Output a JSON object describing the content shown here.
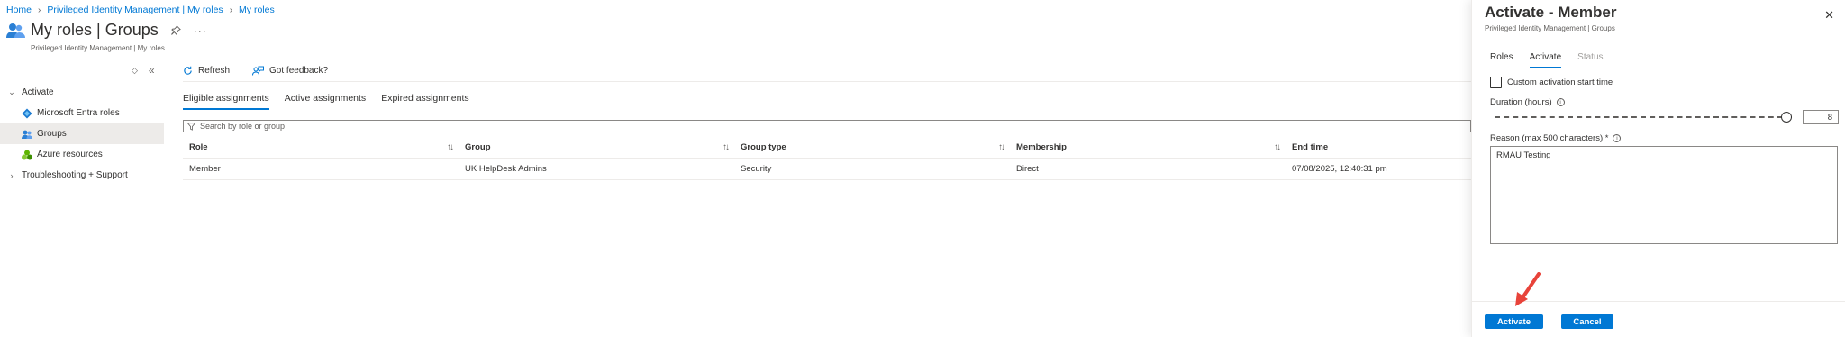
{
  "breadcrumb": [
    "Home",
    "Privileged Identity Management | My roles",
    "My roles"
  ],
  "page": {
    "title": "My roles | Groups",
    "subtitle": "Privileged Identity Management | My roles",
    "more": "···"
  },
  "sidebar": {
    "controls": {
      "toggle": "◇",
      "collapse": "«"
    },
    "items": [
      {
        "label": "Activate",
        "type": "group",
        "expanded": true
      },
      {
        "label": "Microsoft Entra roles",
        "icon": "entra-diamond-icon"
      },
      {
        "label": "Groups",
        "icon": "groups-icon",
        "selected": true
      },
      {
        "label": "Azure resources",
        "icon": "azure-resources-icon"
      },
      {
        "label": "Troubleshooting + Support",
        "type": "group",
        "expanded": false
      }
    ]
  },
  "toolbar": {
    "refresh": "Refresh",
    "feedback": "Got feedback?"
  },
  "tabs": [
    "Eligible assignments",
    "Active assignments",
    "Expired assignments"
  ],
  "search": {
    "placeholder": "Search by role or group"
  },
  "table": {
    "headers": [
      "Role",
      "Group",
      "Group type",
      "Membership",
      "End time"
    ],
    "rows": [
      [
        "Member",
        "UK HelpDesk Admins",
        "Security",
        "Direct",
        "07/08/2025, 12:40:31 pm"
      ]
    ]
  },
  "panel": {
    "title": "Activate - Member",
    "subtitle": "Privileged Identity Management | Groups",
    "close": "✕",
    "tabs": [
      "Roles",
      "Activate",
      "Status"
    ],
    "custom_start_label": "Custom activation start time",
    "custom_start_checked": false,
    "duration_label": "Duration (hours)",
    "duration_value": "8",
    "duration_max": 8,
    "reason_label": "Reason (max 500 characters) *",
    "reason_value": "RMAU Testing",
    "activate_label": "Activate",
    "cancel_label": "Cancel"
  },
  "colors": {
    "accent": "#0078d4",
    "annotation_arrow": "#e8433a"
  }
}
